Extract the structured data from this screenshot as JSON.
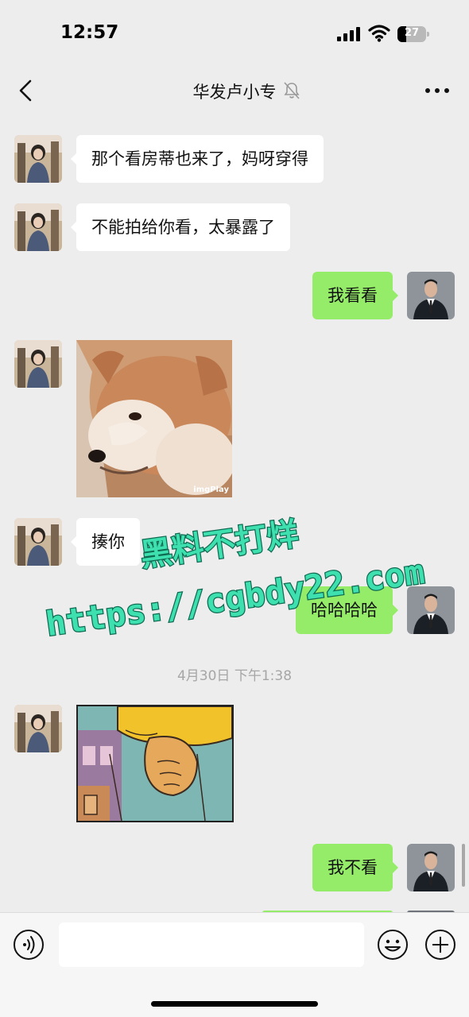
{
  "status_bar": {
    "time": "12:57",
    "battery": "27"
  },
  "nav": {
    "title": "华发卢小专"
  },
  "messages": [
    {
      "side": "left",
      "type": "text",
      "text": "那个看房蒂也来了，妈呀穿得"
    },
    {
      "side": "left",
      "type": "text",
      "text": "不能拍给你看，太暴露了"
    },
    {
      "side": "right",
      "type": "text",
      "text": "我看看"
    },
    {
      "side": "left",
      "type": "image",
      "caption": "imgPlay"
    },
    {
      "side": "left",
      "type": "text",
      "text": "揍你"
    },
    {
      "side": "right",
      "type": "text",
      "text": "哈哈哈哈"
    },
    {
      "side": "left",
      "type": "image"
    },
    {
      "side": "right",
      "type": "text",
      "text": "我不看"
    }
  ],
  "timestamp": "4月30日 下午1:38",
  "watermark": {
    "line1": "黑料不打烊",
    "line2": "https://cgbdy22.com"
  },
  "input": {
    "value": ""
  },
  "colors": {
    "sent_bubble": "#95ec69",
    "received_bubble": "#ffffff",
    "background": "#ededed"
  }
}
